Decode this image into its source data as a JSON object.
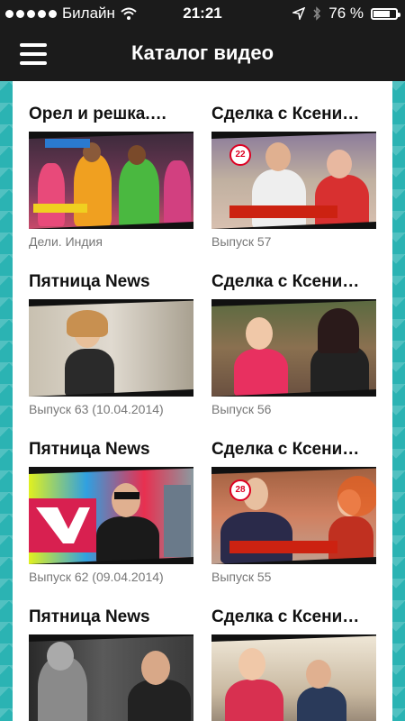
{
  "status": {
    "carrier": "Билайн",
    "time": "21:21",
    "battery": "76 %",
    "battery_level": 0.76
  },
  "nav": {
    "title": "Каталог видео",
    "menu_icon": "hamburger-icon"
  },
  "colors": {
    "bar": "#1b1b1b",
    "pattern": "#2bb3b3",
    "panel": "#ffffff"
  },
  "videos": [
    {
      "title": "Орел и решка.…",
      "subtitle": "Дели. Индия"
    },
    {
      "title": "Сделка с Ксени…",
      "subtitle": "Выпуск 57"
    },
    {
      "title": "Пятница News",
      "subtitle": "Выпуск 63 (10.04.2014)"
    },
    {
      "title": "Сделка с Ксени…",
      "subtitle": "Выпуск 56"
    },
    {
      "title": "Пятница News",
      "subtitle": "Выпуск 62 (09.04.2014)"
    },
    {
      "title": "Сделка с Ксени…",
      "subtitle": "Выпуск 55"
    },
    {
      "title": "Пятница News",
      "subtitle": ""
    },
    {
      "title": "Сделка с Ксени…",
      "subtitle": ""
    }
  ]
}
